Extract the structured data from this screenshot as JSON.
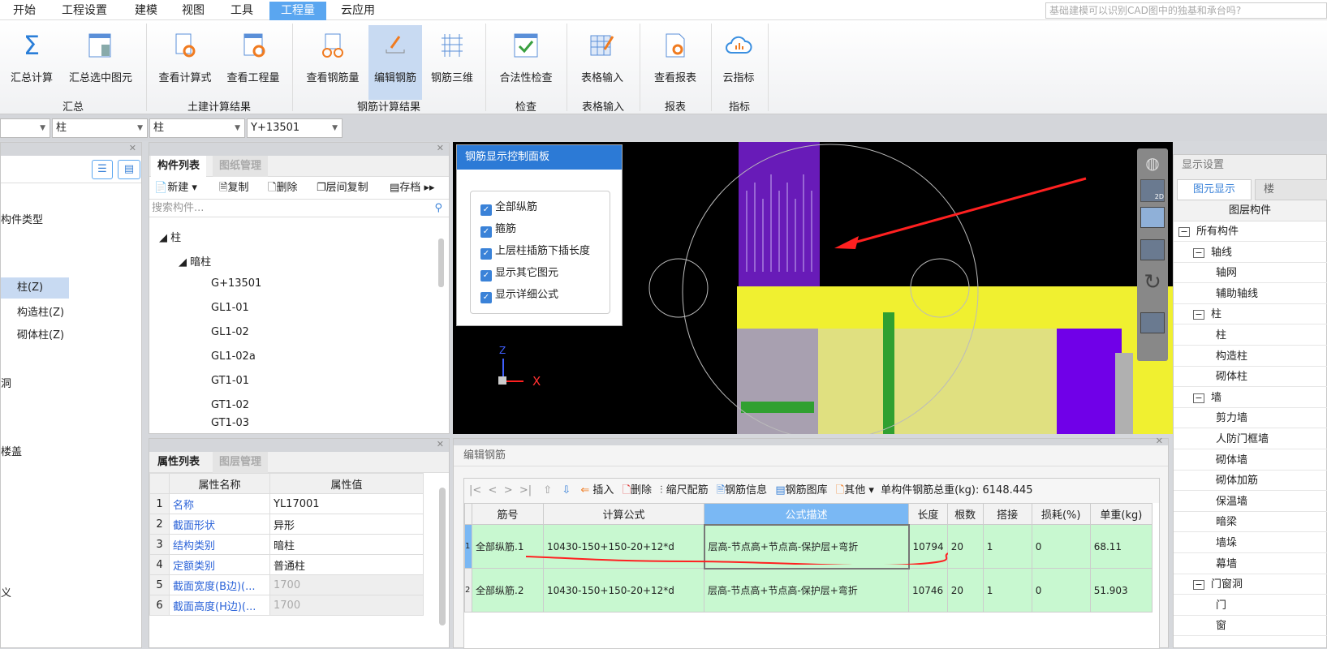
{
  "menu": {
    "tabs": [
      "开始",
      "工程设置",
      "建模",
      "视图",
      "工具",
      "工程量",
      "云应用"
    ],
    "active": "工程量",
    "search_placeholder": "基础建模可以识别CAD图中的独基和承台吗?"
  },
  "ribbon": {
    "buttons": [
      "汇总计算",
      "汇总选中图元",
      "查看计算式",
      "查看工程量",
      "查看钢筋量",
      "编辑钢筋",
      "钢筋三维",
      "合法性检查",
      "表格输入",
      "查看报表",
      "云指标"
    ],
    "selected": "编辑钢筋",
    "groups": [
      "汇总",
      "土建计算结果",
      "钢筋计算结果",
      "检查",
      "表格输入",
      "报表",
      "指标"
    ]
  },
  "dropdowns": [
    "",
    "柱",
    "柱",
    "Y+13501"
  ],
  "left_panel": {
    "header": "构件类型",
    "items": [
      "柱(Z)",
      "构造柱(Z)",
      "砌体柱(Z)"
    ],
    "fragments": [
      "洞",
      "楼盖",
      "义"
    ]
  },
  "component_list": {
    "tabs": [
      "构件列表",
      "图纸管理"
    ],
    "toolbar": [
      "新建",
      "复制",
      "删除",
      "层间复制",
      "存档"
    ],
    "search_placeholder": "搜索构件...",
    "tree_root": "柱",
    "tree_group": "暗柱",
    "items": [
      "G+13501",
      "GL1-01",
      "GL1-02",
      "GL1-02a",
      "GT1-01",
      "GT1-02",
      "GT1-03"
    ]
  },
  "properties": {
    "tabs": [
      "属性列表",
      "图层管理"
    ],
    "headers": [
      "属性名称",
      "属性值"
    ],
    "rows": [
      [
        "1",
        "名称",
        "YL17001"
      ],
      [
        "2",
        "截面形状",
        "异形"
      ],
      [
        "3",
        "结构类别",
        "暗柱"
      ],
      [
        "4",
        "定额类别",
        "普通柱"
      ],
      [
        "5",
        "截面宽度(B边)(...",
        "1700"
      ],
      [
        "6",
        "截面高度(H边)(...",
        "1700"
      ]
    ]
  },
  "rebar_panel": {
    "title": "钢筋显示控制面板",
    "options": [
      "全部纵筋",
      "箍筋",
      "上层柱插筋下插长度",
      "显示其它图元",
      "显示详细公式"
    ]
  },
  "axis": {
    "x": "X",
    "z": "Z"
  },
  "edit_rebar": {
    "title": "编辑钢筋",
    "toolbar": [
      "插入",
      "删除",
      "缩尺配筋",
      "钢筋信息",
      "钢筋图库",
      "其他"
    ],
    "total_label": "单构件钢筋总重(kg):",
    "total_value": "6148.445",
    "headers": [
      "筋号",
      "计算公式",
      "公式描述",
      "长度",
      "根数",
      "搭接",
      "损耗(%)",
      "单重(kg)"
    ],
    "rows": [
      [
        "1",
        "全部纵筋.1",
        "10430-150+150-20+12*d",
        "层高-节点高+节点高-保护层+弯折",
        "10794",
        "20",
        "1",
        "0",
        "68.11"
      ],
      [
        "2",
        "全部纵筋.2",
        "10430-150+150-20+12*d",
        "层高-节点高+节点高-保护层+弯折",
        "10746",
        "20",
        "1",
        "0",
        "51.903"
      ]
    ]
  },
  "view_toolbar": {
    "twod": "2D"
  },
  "display_settings": {
    "title": "显示设置",
    "tabs": [
      "图元显示",
      "楼"
    ],
    "column": "图层构件",
    "tree": [
      [
        "0",
        "所有构件"
      ],
      [
        "1",
        "轴线"
      ],
      [
        "2",
        "轴网"
      ],
      [
        "2",
        "辅助轴线"
      ],
      [
        "1",
        "柱"
      ],
      [
        "2",
        "柱"
      ],
      [
        "2",
        "构造柱"
      ],
      [
        "2",
        "砌体柱"
      ],
      [
        "1",
        "墙"
      ],
      [
        "2",
        "剪力墙"
      ],
      [
        "2",
        "人防门框墙"
      ],
      [
        "2",
        "砌体墙"
      ],
      [
        "2",
        "砌体加筋"
      ],
      [
        "2",
        "保温墙"
      ],
      [
        "2",
        "暗梁"
      ],
      [
        "2",
        "墙垛"
      ],
      [
        "2",
        "幕墙"
      ],
      [
        "1",
        "门窗洞"
      ],
      [
        "2",
        "门"
      ],
      [
        "2",
        "窗"
      ]
    ]
  },
  "colors": {
    "accent": "#5aa6f0",
    "row_green": "#c8f8d0",
    "link_blue": "#2a62d8",
    "annotation_red": "#ff2020"
  }
}
